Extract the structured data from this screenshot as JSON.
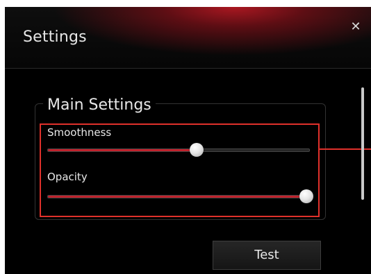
{
  "window": {
    "title": "Settings",
    "close_glyph": "✕",
    "close_icon": "close-icon"
  },
  "main_settings": {
    "title": "Main Settings",
    "sliders": [
      {
        "label": "Smoothness",
        "value": 0.57
      },
      {
        "label": "Opacity",
        "value": 0.99
      }
    ]
  },
  "buttons": {
    "test_label": "Test"
  },
  "colors": {
    "accent": "#c0222c",
    "highlight": "#e0312b",
    "background": "#000000"
  }
}
